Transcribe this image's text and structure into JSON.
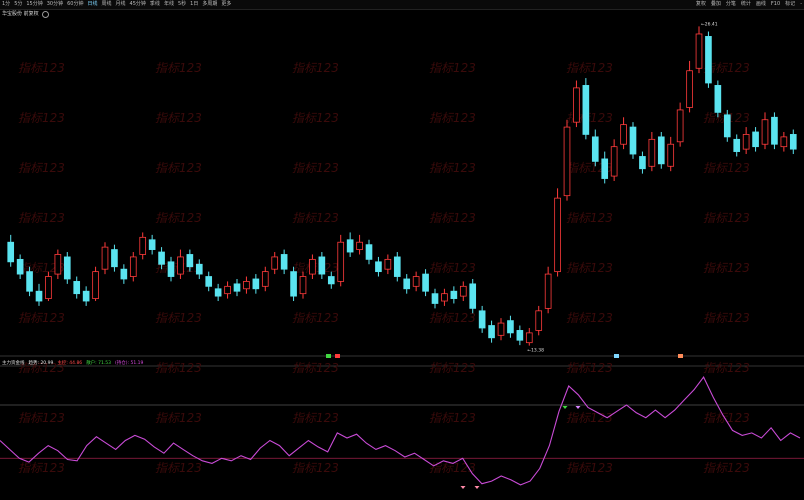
{
  "toolbar": {
    "tabs": [
      "1分",
      "5分",
      "15分钟",
      "30分钟",
      "60分钟",
      "日线",
      "周线",
      "月线",
      "45分钟",
      "季线",
      "年线",
      "5秒",
      "1日",
      "多周期",
      "更多"
    ],
    "active_index": 5,
    "right": [
      "复权",
      "叠加",
      "分笔",
      "统计",
      "画线",
      "F10",
      "标记",
      "-"
    ]
  },
  "title_bar": {
    "label": "华宝股份 前复权",
    "extra": ""
  },
  "indicator_bar": {
    "name": "主力资金线",
    "items": [
      {
        "label": "趋势",
        "value": "20.99",
        "color": "#e9e9e9"
      },
      {
        "label": "主控",
        "value": "44.86",
        "color": "#ff4a4a"
      },
      {
        "label": "散户",
        "value": "71.53",
        "color": "#41d741"
      },
      {
        "label": "(持仓)",
        "value": "51.19",
        "color": "#d84adf"
      }
    ]
  },
  "watermark": "指标123",
  "markers": [
    "解",
    "B",
    "柏",
    "跌"
  ],
  "chart_data": {
    "type": "candlestick",
    "price_high_label": "26.41",
    "price_low_label": "13.38",
    "colors": {
      "up": "#ff3b3b",
      "down": "#5be4f0",
      "line": "#c94bd6",
      "background": "#000000"
    },
    "candles": [
      {
        "o": 17.6,
        "c": 16.8,
        "h": 17.9,
        "l": 16.6
      },
      {
        "o": 16.9,
        "c": 16.3,
        "h": 17.1,
        "l": 16.1
      },
      {
        "o": 16.4,
        "c": 15.6,
        "h": 16.6,
        "l": 15.4
      },
      {
        "o": 15.6,
        "c": 15.2,
        "h": 15.9,
        "l": 15.0
      },
      {
        "o": 15.3,
        "c": 16.2,
        "h": 16.4,
        "l": 15.2
      },
      {
        "o": 16.3,
        "c": 17.1,
        "h": 17.3,
        "l": 16.1
      },
      {
        "o": 17.0,
        "c": 16.1,
        "h": 17.2,
        "l": 15.9
      },
      {
        "o": 16.0,
        "c": 15.5,
        "h": 16.2,
        "l": 15.3
      },
      {
        "o": 15.6,
        "c": 15.2,
        "h": 15.8,
        "l": 15.0
      },
      {
        "o": 15.3,
        "c": 16.4,
        "h": 16.6,
        "l": 15.2
      },
      {
        "o": 16.5,
        "c": 17.4,
        "h": 17.6,
        "l": 16.3
      },
      {
        "o": 17.3,
        "c": 16.6,
        "h": 17.5,
        "l": 16.4
      },
      {
        "o": 16.5,
        "c": 16.1,
        "h": 16.7,
        "l": 15.9
      },
      {
        "o": 16.2,
        "c": 17.0,
        "h": 17.2,
        "l": 16.0
      },
      {
        "o": 17.1,
        "c": 17.8,
        "h": 18.0,
        "l": 16.9
      },
      {
        "o": 17.7,
        "c": 17.3,
        "h": 17.9,
        "l": 17.1
      },
      {
        "o": 17.2,
        "c": 16.7,
        "h": 17.4,
        "l": 16.5
      },
      {
        "o": 16.8,
        "c": 16.2,
        "h": 17.0,
        "l": 16.0
      },
      {
        "o": 16.3,
        "c": 17.0,
        "h": 17.3,
        "l": 16.1
      },
      {
        "o": 17.1,
        "c": 16.6,
        "h": 17.3,
        "l": 16.4
      },
      {
        "o": 16.7,
        "c": 16.3,
        "h": 16.9,
        "l": 16.1
      },
      {
        "o": 16.2,
        "c": 15.8,
        "h": 16.4,
        "l": 15.6
      },
      {
        "o": 15.7,
        "c": 15.4,
        "h": 15.9,
        "l": 15.2
      },
      {
        "o": 15.5,
        "c": 15.8,
        "h": 16.0,
        "l": 15.3
      },
      {
        "o": 15.9,
        "c": 15.6,
        "h": 16.1,
        "l": 15.4
      },
      {
        "o": 15.7,
        "c": 16.0,
        "h": 16.2,
        "l": 15.5
      },
      {
        "o": 16.1,
        "c": 15.7,
        "h": 16.3,
        "l": 15.5
      },
      {
        "o": 15.8,
        "c": 16.4,
        "h": 16.6,
        "l": 15.6
      },
      {
        "o": 16.5,
        "c": 17.0,
        "h": 17.2,
        "l": 16.3
      },
      {
        "o": 17.1,
        "c": 16.5,
        "h": 17.3,
        "l": 16.3
      },
      {
        "o": 16.4,
        "c": 15.4,
        "h": 16.6,
        "l": 15.2
      },
      {
        "o": 15.5,
        "c": 16.2,
        "h": 16.4,
        "l": 15.3
      },
      {
        "o": 16.3,
        "c": 16.9,
        "h": 17.1,
        "l": 16.1
      },
      {
        "o": 17.0,
        "c": 16.3,
        "h": 17.2,
        "l": 16.1
      },
      {
        "o": 16.2,
        "c": 15.9,
        "h": 16.4,
        "l": 15.7
      },
      {
        "o": 16.0,
        "c": 17.6,
        "h": 17.9,
        "l": 15.8
      },
      {
        "o": 17.7,
        "c": 17.2,
        "h": 18.0,
        "l": 17.0
      },
      {
        "o": 17.3,
        "c": 17.6,
        "h": 17.9,
        "l": 17.1
      },
      {
        "o": 17.5,
        "c": 16.9,
        "h": 17.7,
        "l": 16.7
      },
      {
        "o": 16.8,
        "c": 16.4,
        "h": 17.0,
        "l": 16.2
      },
      {
        "o": 16.5,
        "c": 16.9,
        "h": 17.1,
        "l": 16.3
      },
      {
        "o": 17.0,
        "c": 16.2,
        "h": 17.2,
        "l": 16.0
      },
      {
        "o": 16.1,
        "c": 15.7,
        "h": 16.3,
        "l": 15.5
      },
      {
        "o": 15.8,
        "c": 16.2,
        "h": 16.4,
        "l": 15.6
      },
      {
        "o": 16.3,
        "c": 15.6,
        "h": 16.5,
        "l": 15.4
      },
      {
        "o": 15.5,
        "c": 15.1,
        "h": 15.7,
        "l": 14.9
      },
      {
        "o": 15.2,
        "c": 15.5,
        "h": 15.7,
        "l": 15.0
      },
      {
        "o": 15.6,
        "c": 15.3,
        "h": 15.8,
        "l": 15.1
      },
      {
        "o": 15.4,
        "c": 15.8,
        "h": 16.0,
        "l": 15.2
      },
      {
        "o": 15.9,
        "c": 14.9,
        "h": 16.1,
        "l": 14.7
      },
      {
        "o": 14.8,
        "c": 14.1,
        "h": 15.0,
        "l": 13.9
      },
      {
        "o": 14.2,
        "c": 13.7,
        "h": 14.4,
        "l": 13.5
      },
      {
        "o": 13.8,
        "c": 14.3,
        "h": 14.5,
        "l": 13.6
      },
      {
        "o": 14.4,
        "c": 13.9,
        "h": 14.6,
        "l": 13.7
      },
      {
        "o": 14.0,
        "c": 13.6,
        "h": 14.2,
        "l": 13.4
      },
      {
        "o": 13.5,
        "c": 13.9,
        "h": 14.1,
        "l": 13.38
      },
      {
        "o": 14.0,
        "c": 14.8,
        "h": 15.0,
        "l": 13.8
      },
      {
        "o": 14.9,
        "c": 16.3,
        "h": 16.6,
        "l": 14.7
      },
      {
        "o": 16.4,
        "c": 19.4,
        "h": 19.8,
        "l": 16.2
      },
      {
        "o": 19.5,
        "c": 22.3,
        "h": 22.6,
        "l": 19.3
      },
      {
        "o": 22.5,
        "c": 23.9,
        "h": 24.2,
        "l": 22.3
      },
      {
        "o": 24.0,
        "c": 22.0,
        "h": 24.3,
        "l": 21.8
      },
      {
        "o": 21.9,
        "c": 20.9,
        "h": 22.2,
        "l": 20.7
      },
      {
        "o": 21.0,
        "c": 20.2,
        "h": 21.3,
        "l": 20.0
      },
      {
        "o": 20.3,
        "c": 21.5,
        "h": 21.8,
        "l": 20.1
      },
      {
        "o": 21.6,
        "c": 22.4,
        "h": 22.7,
        "l": 21.4
      },
      {
        "o": 22.3,
        "c": 21.2,
        "h": 22.5,
        "l": 21.0
      },
      {
        "o": 21.1,
        "c": 20.6,
        "h": 21.3,
        "l": 20.4
      },
      {
        "o": 20.7,
        "c": 21.8,
        "h": 22.1,
        "l": 20.5
      },
      {
        "o": 21.9,
        "c": 20.8,
        "h": 22.1,
        "l": 20.6
      },
      {
        "o": 20.7,
        "c": 21.6,
        "h": 21.9,
        "l": 20.5
      },
      {
        "o": 21.7,
        "c": 23.0,
        "h": 23.3,
        "l": 21.5
      },
      {
        "o": 23.1,
        "c": 24.6,
        "h": 25.0,
        "l": 22.9
      },
      {
        "o": 24.7,
        "c": 26.1,
        "h": 26.41,
        "l": 24.5
      },
      {
        "o": 26.0,
        "c": 24.1,
        "h": 26.2,
        "l": 23.9
      },
      {
        "o": 24.0,
        "c": 22.9,
        "h": 24.2,
        "l": 22.7
      },
      {
        "o": 22.8,
        "c": 21.9,
        "h": 23.0,
        "l": 21.7
      },
      {
        "o": 21.8,
        "c": 21.3,
        "h": 22.0,
        "l": 21.1
      },
      {
        "o": 21.4,
        "c": 22.0,
        "h": 22.3,
        "l": 21.2
      },
      {
        "o": 22.1,
        "c": 21.5,
        "h": 22.3,
        "l": 21.3
      },
      {
        "o": 21.6,
        "c": 22.6,
        "h": 22.9,
        "l": 21.4
      },
      {
        "o": 22.7,
        "c": 21.6,
        "h": 22.9,
        "l": 21.4
      },
      {
        "o": 21.5,
        "c": 21.9,
        "h": 22.1,
        "l": 21.3
      },
      {
        "o": 22.0,
        "c": 21.4,
        "h": 22.2,
        "l": 21.2
      }
    ],
    "indicator": [
      62,
      55,
      48,
      45,
      52,
      58,
      54,
      47,
      46,
      58,
      65,
      60,
      55,
      62,
      66,
      63,
      57,
      52,
      60,
      55,
      50,
      46,
      44,
      48,
      46,
      50,
      47,
      56,
      62,
      58,
      50,
      56,
      62,
      57,
      53,
      68,
      64,
      67,
      60,
      55,
      58,
      54,
      49,
      52,
      47,
      42,
      46,
      44,
      48,
      36,
      28,
      30,
      34,
      31,
      27,
      30,
      40,
      58,
      85,
      105,
      98,
      88,
      84,
      80,
      85,
      90,
      84,
      80,
      86,
      80,
      86,
      94,
      102,
      112,
      96,
      82,
      70,
      66,
      68,
      64,
      72,
      62,
      68,
      64
    ],
    "ind_low_line": 48,
    "ind_high_line": 90
  }
}
